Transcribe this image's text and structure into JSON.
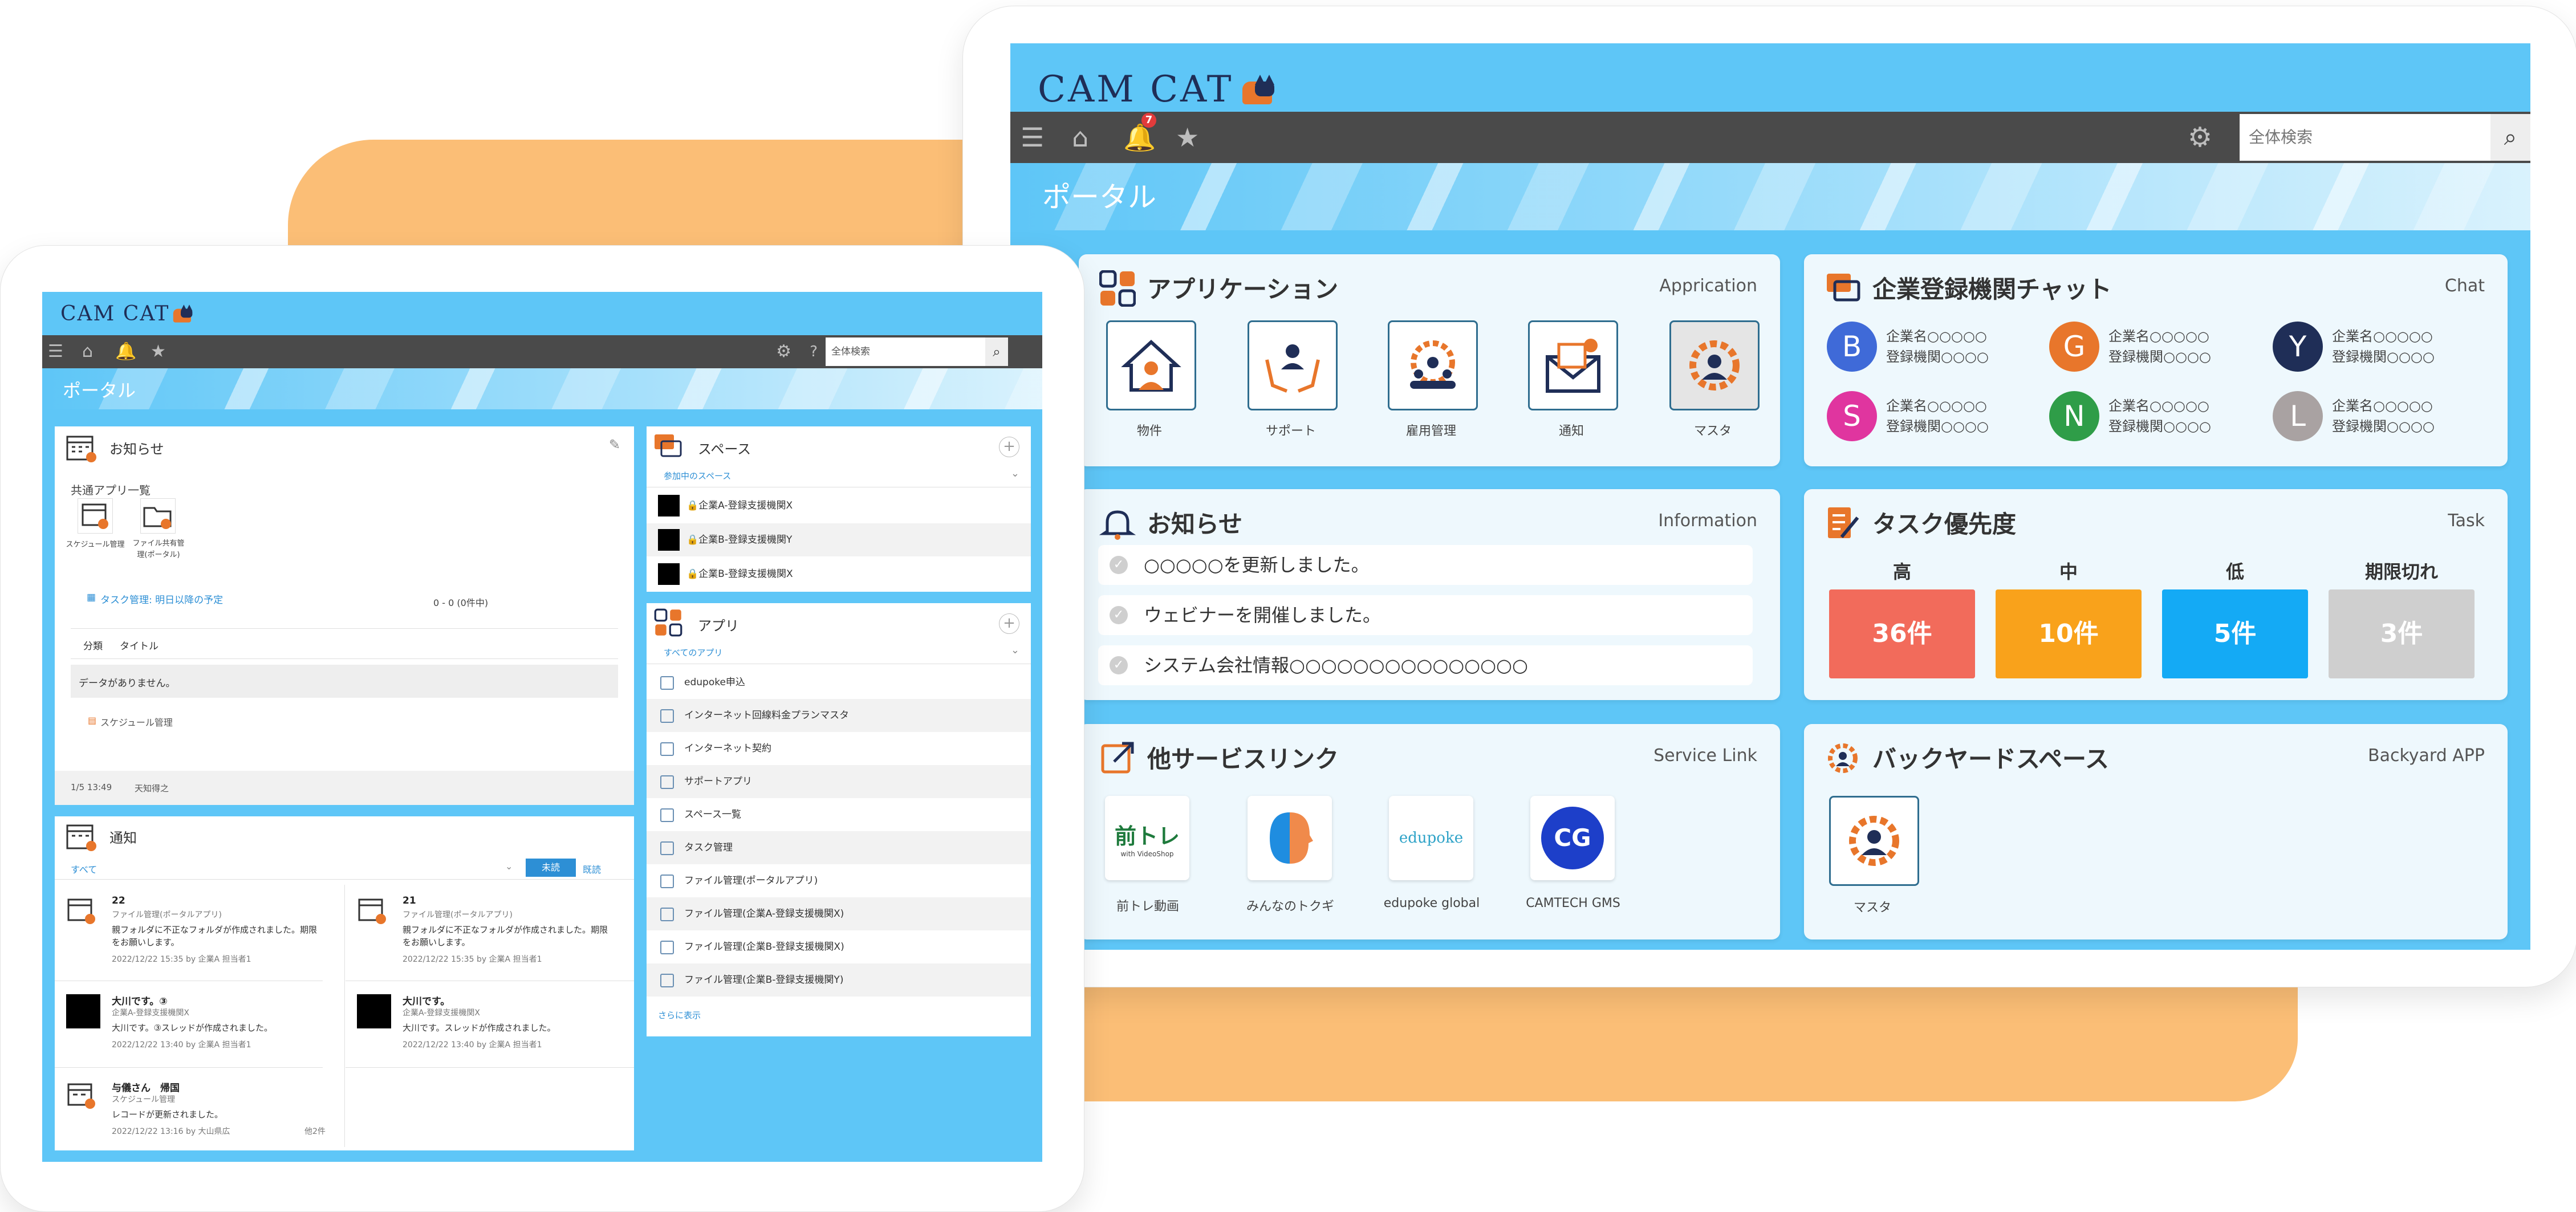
{
  "right": {
    "logo": "CAM CAT",
    "search_placeholder": "全体検索",
    "bell_count": "7",
    "portal_title": "ポータル",
    "apps": {
      "title": "アプリケーション",
      "en": "Apprication",
      "items": [
        {
          "label": "物件",
          "icon": "house-icon"
        },
        {
          "label": "サポート",
          "icon": "support-hands-icon"
        },
        {
          "label": "雇用管理",
          "icon": "employment-gear-icon"
        },
        {
          "label": "通知",
          "icon": "mail-icon"
        },
        {
          "label": "マスタ",
          "icon": "master-gear-icon"
        }
      ]
    },
    "chat": {
      "title": "企業登録機関チャット",
      "en": "Chat",
      "items": [
        {
          "initial": "B",
          "color": "#3f6ad8",
          "line1": "企業名○○○○○",
          "line2": "登録機関○○○○"
        },
        {
          "initial": "G",
          "color": "#e8762b",
          "line1": "企業名○○○○○",
          "line2": "登録機関○○○○"
        },
        {
          "initial": "Y",
          "color": "#1f2e57",
          "line1": "企業名○○○○○",
          "line2": "登録機関○○○○"
        },
        {
          "initial": "S",
          "color": "#e0359f",
          "line1": "企業名○○○○○",
          "line2": "登録機関○○○○"
        },
        {
          "initial": "N",
          "color": "#2f9d48",
          "line1": "企業名○○○○○",
          "line2": "登録機関○○○○"
        },
        {
          "initial": "L",
          "color": "#a9a2a2",
          "line1": "企業名○○○○○",
          "line2": "登録機関○○○○"
        }
      ]
    },
    "info": {
      "title": "お知らせ",
      "en": "Information",
      "items": [
        "○○○○○を更新しました。",
        "ウェビナーを開催しました。",
        "システム会社情報○○○○○○○○○○○○○○○"
      ]
    },
    "task": {
      "title": "タスク優先度",
      "en": "Task",
      "cols": [
        {
          "label": "高",
          "value": "36件",
          "color": "#f26b5b"
        },
        {
          "label": "中",
          "value": "10件",
          "color": "#f9a21b"
        },
        {
          "label": "低",
          "value": "5件",
          "color": "#14aaf5"
        },
        {
          "label": "期限切れ",
          "value": "3件",
          "color": "#cfcfcf"
        }
      ]
    },
    "links": {
      "title": "他サービスリンク",
      "en": "Service Link",
      "items": [
        {
          "label": "前トレ動画",
          "logo": "前トレ",
          "sub": "with VideoShop"
        },
        {
          "label": "みんなのトクギ",
          "logo": "face-profile"
        },
        {
          "label": "edupoke global",
          "logo": "edupoke"
        },
        {
          "label": "CAMTECH GMS",
          "logo": "CG"
        }
      ]
    },
    "backyard": {
      "title": "バックヤードスペース",
      "en": "Backyard APP",
      "items": [
        {
          "label": "マスタ"
        }
      ]
    }
  },
  "left": {
    "logo": "CAM CAT",
    "search_placeholder": "全体検索",
    "portal_title": "ポータル",
    "news": {
      "title": "お知らせ",
      "common_apps": "共通アプリ一覧",
      "apps": [
        {
          "label": "スケジュール管理"
        },
        {
          "label": "ファイル共有管理(ポータル)"
        }
      ],
      "task_link": "タスク管理: 明日以降の予定",
      "count": "0 - 0 (0件中)",
      "col_category": "分類",
      "col_title": "タイトル",
      "empty": "データがありません。",
      "schedule_link": "スケジュール管理",
      "footer_date": "1/5 13:49",
      "footer_weather": "天知得之"
    },
    "notif": {
      "title": "通知",
      "filter": "すべて",
      "btn_unread": "未読",
      "btn_read": "既読",
      "items": [
        {
          "title": "22",
          "app": "ファイル管理(ポータルアプリ)",
          "body": "親フォルダに不正なフォルダが作成されました。期限をお願いします。",
          "meta": "2022/12/22 15:35 by 企業A 担当者1",
          "kind": "icon"
        },
        {
          "title": "21",
          "app": "ファイル管理(ポータルアプリ)",
          "body": "親フォルダに不正なフォルダが作成されました。期限をお願いします。",
          "meta": "2022/12/22 15:35 by 企業A 担当者1",
          "kind": "icon"
        },
        {
          "title": "大川です。③",
          "app": "企業A-登録支援機関X",
          "body": "大川です。③スレッドが作成されました。",
          "meta": "2022/12/22 13:40 by 企業A 担当者1",
          "kind": "black"
        },
        {
          "title": "大川です。",
          "app": "企業A-登録支援機関X",
          "body": "大川です。スレッドが作成されました。",
          "meta": "2022/12/22 13:40 by 企業A 担当者1",
          "kind": "black"
        },
        {
          "title": "与儀さん　帰国",
          "app": "スケジュール管理",
          "body": "レコードが更新されました。",
          "meta": "2022/12/22 13:16 by 大山県広",
          "extra": "他2件",
          "kind": "icon"
        }
      ]
    },
    "space": {
      "title": "スペース",
      "filter": "参加中のスペース",
      "items": [
        "🔒企業A-登録支援機関X",
        "🔒企業B-登録支援機関Y",
        "🔒企業B-登録支援機関X"
      ]
    },
    "app": {
      "title": "アプリ",
      "filter": "すべてのアプリ",
      "items": [
        "edupoke申込",
        "インターネット回線料金プランマスタ",
        "インターネット契約",
        "サポートアプリ",
        "スペース一覧",
        "タスク管理",
        "ファイル管理(ポータルアプリ)",
        "ファイル管理(企業A-登録支援機関X)",
        "ファイル管理(企業B-登録支援機関X)",
        "ファイル管理(企業B-登録支援機関Y)"
      ],
      "more": "さらに表示"
    }
  }
}
